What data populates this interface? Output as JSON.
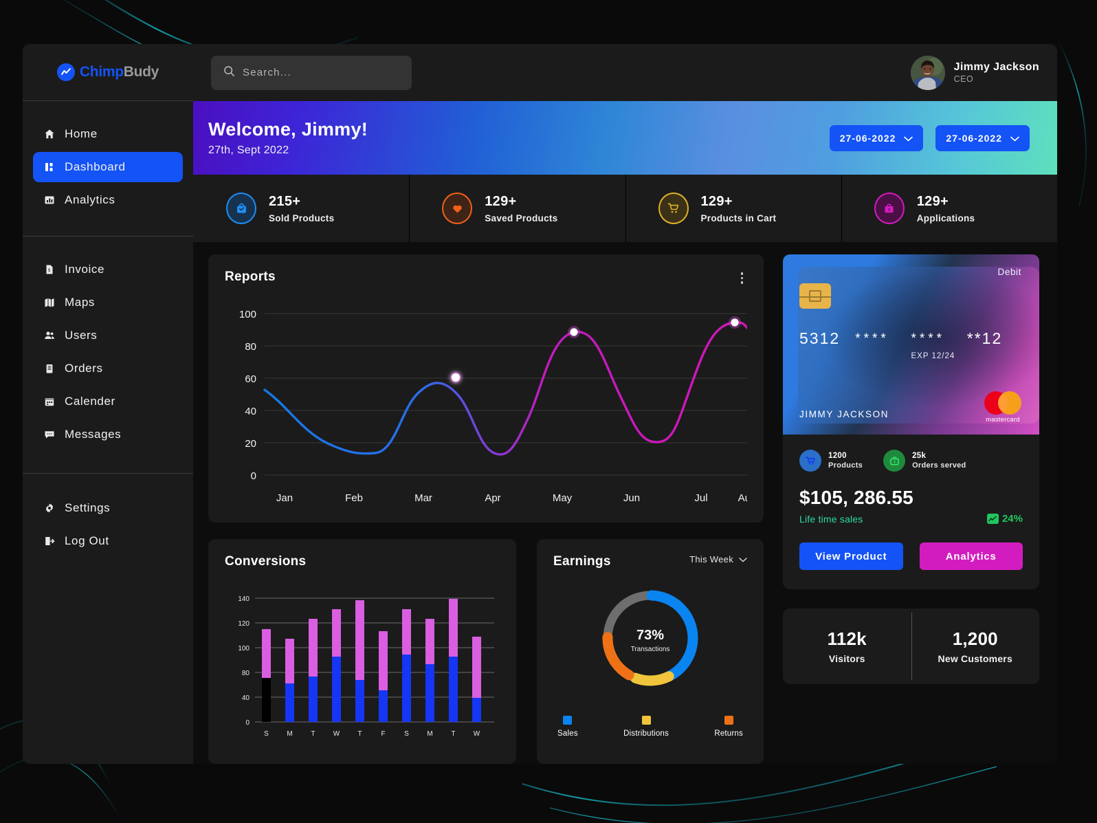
{
  "brand": {
    "name_part1": "Chimp",
    "name_part2": "Budy",
    "logo_icon": "chart-line-circle-icon"
  },
  "sidebar": {
    "group1": [
      {
        "label": "Home",
        "icon": "home-icon",
        "active": false
      },
      {
        "label": "Dashboard",
        "icon": "dashboard-grid-icon",
        "active": true
      },
      {
        "label": "Analytics",
        "icon": "analytics-bars-icon",
        "active": false
      }
    ],
    "group2": [
      {
        "label": "Invoice",
        "icon": "invoice-document-icon"
      },
      {
        "label": "Maps",
        "icon": "map-icon"
      },
      {
        "label": "Users",
        "icon": "users-icon"
      },
      {
        "label": "Orders",
        "icon": "clipboard-orders-icon"
      },
      {
        "label": "Calender",
        "icon": "calendar-icon"
      },
      {
        "label": "Messages",
        "icon": "messages-chat-icon"
      }
    ],
    "group3": [
      {
        "label": "Settings",
        "icon": "gear-icon"
      },
      {
        "label": "Log Out",
        "icon": "logout-icon"
      }
    ]
  },
  "topbar": {
    "search_placeholder": "Search...",
    "search_value": "",
    "search_icon": "search-icon",
    "profile": {
      "name": "Jimmy Jackson",
      "role": "CEO",
      "avatar": "user-avatar"
    }
  },
  "banner": {
    "greeting": "Welcome, Jimmy!",
    "date": "27th, Sept 2022",
    "date_pickers": [
      {
        "value": "27-06-2022",
        "icon": "chevron-down-icon"
      },
      {
        "value": "27-06-2022",
        "icon": "chevron-down-icon"
      }
    ]
  },
  "stats": [
    {
      "value": "215+",
      "label": "Sold Products",
      "icon": "shopping-bag-icon",
      "color": "#1e8ef5"
    },
    {
      "value": "129+",
      "label": "Saved Products",
      "icon": "heart-icon",
      "color": "#f2601a"
    },
    {
      "value": "129+",
      "label": "Products in Cart",
      "icon": "cart-icon",
      "color": "#e0b229"
    },
    {
      "value": "129+",
      "label": "Applications",
      "icon": "briefcase-icon",
      "color": "#d31cc0"
    }
  ],
  "reports": {
    "title": "Reports",
    "menu_icon": "kebab-menu-icon"
  },
  "conversions": {
    "title": "Conversions"
  },
  "earnings": {
    "title": "Earnings",
    "period": "This Week",
    "period_icon": "chevron-down-icon",
    "center_value": "73%",
    "center_label": "Transactions"
  },
  "wallet": {
    "card": {
      "type_label": "Debit",
      "number_groups": [
        "5312",
        "****",
        "****",
        "**12"
      ],
      "expiry": "EXP 12/24",
      "holder": "JIMMY JACKSON",
      "network": "mastercard",
      "chip_icon": "card-chip-icon"
    },
    "mini_stats": [
      {
        "value": "1200",
        "label": "Products",
        "icon": "cart-icon",
        "color": "#2a6fc9"
      },
      {
        "value": "25k",
        "label": "Orders served",
        "icon": "briefcase-icon",
        "color": "#1f8a3c"
      }
    ],
    "sales_amount": "$105, 286.55",
    "sales_label": "Life time sales",
    "trend_value": "24%",
    "trend_icon": "trend-up-icon",
    "buttons": {
      "primary": "View Product",
      "secondary": "Analytics"
    }
  },
  "visitors": [
    {
      "value": "112k",
      "label": "Visitors"
    },
    {
      "value": "1,200",
      "label": "New Customers"
    }
  ],
  "chart_data": [
    {
      "type": "line",
      "title": "Reports",
      "xlabel": "",
      "ylabel": "",
      "categories": [
        "Jan",
        "Feb",
        "Mar",
        "Apr",
        "May",
        "Jun",
        "Jul",
        "Aug"
      ],
      "values": [
        53,
        15,
        60,
        14,
        88,
        35,
        93,
        80
      ],
      "ytick_labels": [
        "0",
        "20",
        "40",
        "60",
        "80",
        "100"
      ],
      "yticks": [
        0,
        20,
        40,
        60,
        80,
        100
      ],
      "ylim": [
        0,
        110
      ],
      "grid": true,
      "legend": "none",
      "markers": [
        {
          "x": "Mar",
          "y": 60
        },
        {
          "x": "May",
          "y": 88
        },
        {
          "x": "Jul",
          "y": 93
        }
      ],
      "line_gradient": [
        "#1479e8",
        "#2d6fe8",
        "#8e3fd0",
        "#d216b8",
        "#d216b8"
      ]
    },
    {
      "type": "bar",
      "title": "Conversions",
      "categories": [
        "S",
        "M",
        "T",
        "W",
        "T",
        "F",
        "S",
        "M",
        "T",
        "W"
      ],
      "series": [
        {
          "name": "Base",
          "color": "#1536f5",
          "values": [
            72,
            64,
            74,
            107,
            69,
            52,
            110,
            94,
            107,
            40
          ]
        },
        {
          "name": "Top",
          "color": "#d95fe0",
          "values": [
            24,
            19,
            40,
            14,
            65,
            42,
            12,
            13,
            29,
            50
          ]
        }
      ],
      "totals": [
        96,
        83,
        114,
        121,
        134,
        94,
        122,
        107,
        136,
        90
      ],
      "ytick_labels": [
        "0",
        "40",
        "80",
        "100",
        "120",
        "140"
      ],
      "yticks": [
        0,
        40,
        80,
        100,
        120,
        140
      ],
      "ylim": [
        0,
        150
      ],
      "stacked": true,
      "grid": true
    },
    {
      "type": "pie",
      "title": "Earnings",
      "subtitle": "This Week",
      "center_value": "73%",
      "center_label": "Transactions",
      "labels": [
        "Sales",
        "Distributions",
        "Returns"
      ],
      "values": [
        42,
        13,
        18
      ],
      "colors": [
        "#0a84f0",
        "#f0c53c",
        "#ef7116"
      ],
      "track_color": "#6e6e6e",
      "legend": "bottom",
      "donut": true
    }
  ]
}
